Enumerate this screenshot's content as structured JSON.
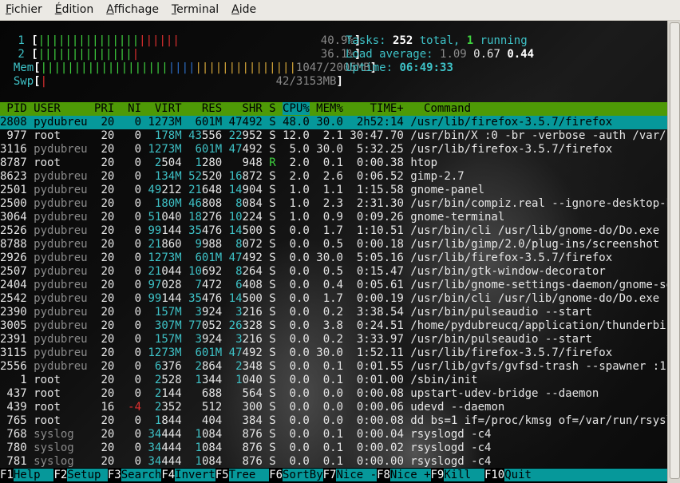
{
  "menu": [
    "Fichier",
    "Édition",
    "Affichage",
    "Terminal",
    "Aide"
  ],
  "meters": {
    "cpu1": {
      "label": "1",
      "bar_green": "|||||||||||||||",
      "bar_red": "||||||",
      "value": "40.9%"
    },
    "cpu2": {
      "label": "2",
      "bar_green": "||||||||||||||",
      "bar_red": "|",
      "value": "36.1%"
    },
    "mem": {
      "label": "Mem",
      "bar_green": "|||||||||||||||||||",
      "bar_blue": "||||",
      "bar_yellow": "|||||||||||||||",
      "value": "1047/2005MB"
    },
    "swp": {
      "label": "Swp",
      "bar_red": "|",
      "value": "42/3153MB"
    }
  },
  "summary": {
    "tasks_label": "Tasks:",
    "tasks_total": "252",
    "total_word": "total,",
    "running": "1",
    "running_word": "running",
    "load_label": "Load average:",
    "load1": "1.09",
    "load5": "0.67",
    "load15": "0.44",
    "uptime_label": "Uptime:",
    "uptime": "06:49:33"
  },
  "header": {
    "pid": "PID",
    "user": "USER",
    "pri": "PRI",
    "ni": "NI",
    "virt": "VIRT",
    "res": "RES",
    "shr": "SHR",
    "s": "S",
    "cpu": "CPU%",
    "mem": "MEM%",
    "time": "TIME+",
    "command": "Command"
  },
  "processes": [
    {
      "pid": "2808",
      "user": "pydubreu",
      "pri": "20",
      "ni": "0",
      "virt": "1273M",
      "res": "601M",
      "shr": "47492",
      "s": "S",
      "cpu": "48.0",
      "mem": "30.0",
      "time": "2h52:14",
      "command": "/usr/lib/firefox-3.5.7/firefox"
    },
    {
      "pid": "977",
      "user": "root",
      "pri": "20",
      "ni": "0",
      "virt": "178M",
      "res": "43556",
      "shr": "22952",
      "s": "S",
      "cpu": "12.0",
      "mem": "2.1",
      "time": "30:47.70",
      "command": "/usr/bin/X :0 -br -verbose -auth /var/run/"
    },
    {
      "pid": "3116",
      "user": "pydubreu",
      "pri": "20",
      "ni": "0",
      "virt": "1273M",
      "res": "601M",
      "shr": "47492",
      "s": "S",
      "cpu": "5.0",
      "mem": "30.0",
      "time": "5:32.25",
      "command": "/usr/lib/firefox-3.5.7/firefox"
    },
    {
      "pid": "8787",
      "user": "root",
      "pri": "20",
      "ni": "0",
      "virt": "2504",
      "res": "1280",
      "shr": "948",
      "s": "R",
      "cpu": "2.0",
      "mem": "0.1",
      "time": "0:00.38",
      "command": "htop"
    },
    {
      "pid": "8623",
      "user": "pydubreu",
      "pri": "20",
      "ni": "0",
      "virt": "134M",
      "res": "52520",
      "shr": "16872",
      "s": "S",
      "cpu": "2.0",
      "mem": "2.6",
      "time": "0:06.52",
      "command": "gimp-2.7"
    },
    {
      "pid": "2501",
      "user": "pydubreu",
      "pri": "20",
      "ni": "0",
      "virt": "49212",
      "res": "21648",
      "shr": "14904",
      "s": "S",
      "cpu": "1.0",
      "mem": "1.1",
      "time": "1:15.58",
      "command": "gnome-panel"
    },
    {
      "pid": "2500",
      "user": "pydubreu",
      "pri": "20",
      "ni": "0",
      "virt": "180M",
      "res": "46808",
      "shr": "8084",
      "s": "S",
      "cpu": "1.0",
      "mem": "2.3",
      "time": "2:31.30",
      "command": "/usr/bin/compiz.real --ignore-desktop-hint"
    },
    {
      "pid": "3064",
      "user": "pydubreu",
      "pri": "20",
      "ni": "0",
      "virt": "51040",
      "res": "18276",
      "shr": "10224",
      "s": "S",
      "cpu": "1.0",
      "mem": "0.9",
      "time": "0:09.26",
      "command": "gnome-terminal"
    },
    {
      "pid": "2526",
      "user": "pydubreu",
      "pri": "20",
      "ni": "0",
      "virt": "99144",
      "res": "35476",
      "shr": "14500",
      "s": "S",
      "cpu": "0.0",
      "mem": "1.7",
      "time": "1:10.51",
      "command": "/usr/bin/cli /usr/lib/gnome-do/Do.exe"
    },
    {
      "pid": "8788",
      "user": "pydubreu",
      "pri": "20",
      "ni": "0",
      "virt": "21860",
      "res": "9988",
      "shr": "8072",
      "s": "S",
      "cpu": "0.0",
      "mem": "0.5",
      "time": "0:00.18",
      "command": "/usr/lib/gimp/2.0/plug-ins/screenshot -gim"
    },
    {
      "pid": "2926",
      "user": "pydubreu",
      "pri": "20",
      "ni": "0",
      "virt": "1273M",
      "res": "601M",
      "shr": "47492",
      "s": "S",
      "cpu": "0.0",
      "mem": "30.0",
      "time": "5:05.16",
      "command": "/usr/lib/firefox-3.5.7/firefox"
    },
    {
      "pid": "2507",
      "user": "pydubreu",
      "pri": "20",
      "ni": "0",
      "virt": "21044",
      "res": "10692",
      "shr": "8264",
      "s": "S",
      "cpu": "0.0",
      "mem": "0.5",
      "time": "0:15.47",
      "command": "/usr/bin/gtk-window-decorator"
    },
    {
      "pid": "2404",
      "user": "pydubreu",
      "pri": "20",
      "ni": "0",
      "virt": "97028",
      "res": "7472",
      "shr": "6408",
      "s": "S",
      "cpu": "0.0",
      "mem": "0.4",
      "time": "0:05.61",
      "command": "/usr/lib/gnome-settings-daemon/gnome-setti"
    },
    {
      "pid": "2542",
      "user": "pydubreu",
      "pri": "20",
      "ni": "0",
      "virt": "99144",
      "res": "35476",
      "shr": "14500",
      "s": "S",
      "cpu": "0.0",
      "mem": "1.7",
      "time": "0:00.19",
      "command": "/usr/bin/cli /usr/lib/gnome-do/Do.exe"
    },
    {
      "pid": "2390",
      "user": "pydubreu",
      "pri": "20",
      "ni": "0",
      "virt": "157M",
      "res": "3924",
      "shr": "3216",
      "s": "S",
      "cpu": "0.0",
      "mem": "0.2",
      "time": "3:38.54",
      "command": "/usr/bin/pulseaudio --start"
    },
    {
      "pid": "3005",
      "user": "pydubreu",
      "pri": "20",
      "ni": "0",
      "virt": "307M",
      "res": "77052",
      "shr": "26328",
      "s": "S",
      "cpu": "0.0",
      "mem": "3.8",
      "time": "0:24.51",
      "command": "/home/pydubreucq/application/thunderbird/t"
    },
    {
      "pid": "2391",
      "user": "pydubreu",
      "pri": "20",
      "ni": "0",
      "virt": "157M",
      "res": "3924",
      "shr": "3216",
      "s": "S",
      "cpu": "0.0",
      "mem": "0.2",
      "time": "3:33.97",
      "command": "/usr/bin/pulseaudio --start"
    },
    {
      "pid": "3115",
      "user": "pydubreu",
      "pri": "20",
      "ni": "0",
      "virt": "1273M",
      "res": "601M",
      "shr": "47492",
      "s": "S",
      "cpu": "0.0",
      "mem": "30.0",
      "time": "1:52.11",
      "command": "/usr/lib/firefox-3.5.7/firefox"
    },
    {
      "pid": "2556",
      "user": "pydubreu",
      "pri": "20",
      "ni": "0",
      "virt": "6376",
      "res": "2864",
      "shr": "2348",
      "s": "S",
      "cpu": "0.0",
      "mem": "0.1",
      "time": "0:01.55",
      "command": "/usr/lib/gvfs/gvfsd-trash --spawner :1.9 /"
    },
    {
      "pid": "1",
      "user": "root",
      "pri": "20",
      "ni": "0",
      "virt": "2528",
      "res": "1344",
      "shr": "1040",
      "s": "S",
      "cpu": "0.0",
      "mem": "0.1",
      "time": "0:01.00",
      "command": "/sbin/init"
    },
    {
      "pid": "437",
      "user": "root",
      "pri": "20",
      "ni": "0",
      "virt": "2144",
      "res": "688",
      "shr": "564",
      "s": "S",
      "cpu": "0.0",
      "mem": "0.0",
      "time": "0:00.08",
      "command": "upstart-udev-bridge --daemon"
    },
    {
      "pid": "439",
      "user": "root",
      "pri": "16",
      "ni": "-4",
      "virt": "2352",
      "res": "512",
      "shr": "300",
      "s": "S",
      "cpu": "0.0",
      "mem": "0.0",
      "time": "0:00.06",
      "command": "udevd --daemon"
    },
    {
      "pid": "765",
      "user": "root",
      "pri": "20",
      "ni": "0",
      "virt": "1844",
      "res": "404",
      "shr": "384",
      "s": "S",
      "cpu": "0.0",
      "mem": "0.0",
      "time": "0:00.08",
      "command": "dd bs=1 if=/proc/kmsg of=/var/run/rsyslog/"
    },
    {
      "pid": "768",
      "user": "syslog",
      "pri": "20",
      "ni": "0",
      "virt": "34444",
      "res": "1084",
      "shr": "876",
      "s": "S",
      "cpu": "0.0",
      "mem": "0.1",
      "time": "0:00.04",
      "command": "rsyslogd -c4"
    },
    {
      "pid": "780",
      "user": "syslog",
      "pri": "20",
      "ni": "0",
      "virt": "34444",
      "res": "1084",
      "shr": "876",
      "s": "S",
      "cpu": "0.0",
      "mem": "0.1",
      "time": "0:00.02",
      "command": "rsyslogd -c4"
    },
    {
      "pid": "781",
      "user": "syslog",
      "pri": "20",
      "ni": "0",
      "virt": "34444",
      "res": "1084",
      "shr": "876",
      "s": "S",
      "cpu": "0.0",
      "mem": "0.1",
      "time": "0:00.00",
      "command": "rsyslogd -c4"
    }
  ],
  "fkeys": [
    {
      "key": "F1",
      "label": "Help  "
    },
    {
      "key": "F2",
      "label": "Setup "
    },
    {
      "key": "F3",
      "label": "Search"
    },
    {
      "key": "F4",
      "label": "Invert"
    },
    {
      "key": "F5",
      "label": "Tree  "
    },
    {
      "key": "F6",
      "label": "SortBy"
    },
    {
      "key": "F7",
      "label": "Nice -"
    },
    {
      "key": "F8",
      "label": "Nice +"
    },
    {
      "key": "F9",
      "label": "Kill  "
    },
    {
      "key": "F10",
      "label": "Quit"
    }
  ]
}
